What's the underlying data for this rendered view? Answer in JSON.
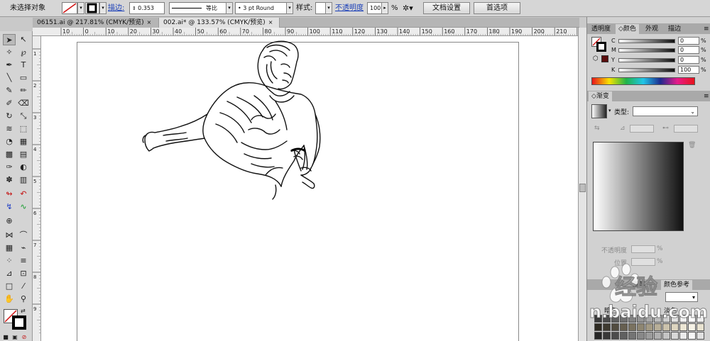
{
  "control_bar": {
    "selection_status": "未选择对象",
    "stroke_label": "描边:",
    "stroke_weight": "0.353",
    "profile_label": "等比",
    "brush_value": "3 pt Round",
    "style_label": "样式:",
    "opacity_label": "不透明度",
    "opacity_value": "100",
    "percent": "%",
    "doc_setup_button": "文档设置",
    "preferences_button": "首选项"
  },
  "tabs": [
    {
      "label": "06151.ai @ 217.81% (CMYK/预览)",
      "close": "×"
    },
    {
      "label": "002.ai* @ 133.57% (CMYK/预览)",
      "close": "×"
    }
  ],
  "ruler_h": [
    "10",
    "0",
    "10",
    "20",
    "30",
    "40",
    "50",
    "60",
    "70",
    "80",
    "90",
    "100",
    "110",
    "120",
    "130",
    "140",
    "150",
    "160",
    "170",
    "180",
    "190",
    "200",
    "210",
    "220",
    "230"
  ],
  "ruler_v": [
    "1",
    "2",
    "3",
    "4",
    "5",
    "6",
    "7",
    "8",
    "9"
  ],
  "color_panel": {
    "tabs": [
      "透明度",
      "颜色",
      "外观",
      "描边"
    ],
    "channels": [
      {
        "label": "C",
        "value": "0"
      },
      {
        "label": "M",
        "value": "0"
      },
      {
        "label": "Y",
        "value": "0"
      },
      {
        "label": "K",
        "value": "100"
      }
    ],
    "percent": "%"
  },
  "gradient_panel": {
    "tab": "渐变",
    "type_label": "类型:",
    "opacity_label": "不透明度",
    "position_label": "位置",
    "percent": "%"
  },
  "swatch_panel": {
    "tabs": [
      "画笔",
      "颜色参考"
    ],
    "dark_label": "暗色",
    "light_label": "淡色"
  },
  "watermark": {
    "text_main": "经验",
    "text_url": "n.baidu.com"
  },
  "colors": {
    "accent_link": "#1a3fb8",
    "fill_black": "#000000",
    "swatch_dark_red": "#5a0d0d"
  }
}
